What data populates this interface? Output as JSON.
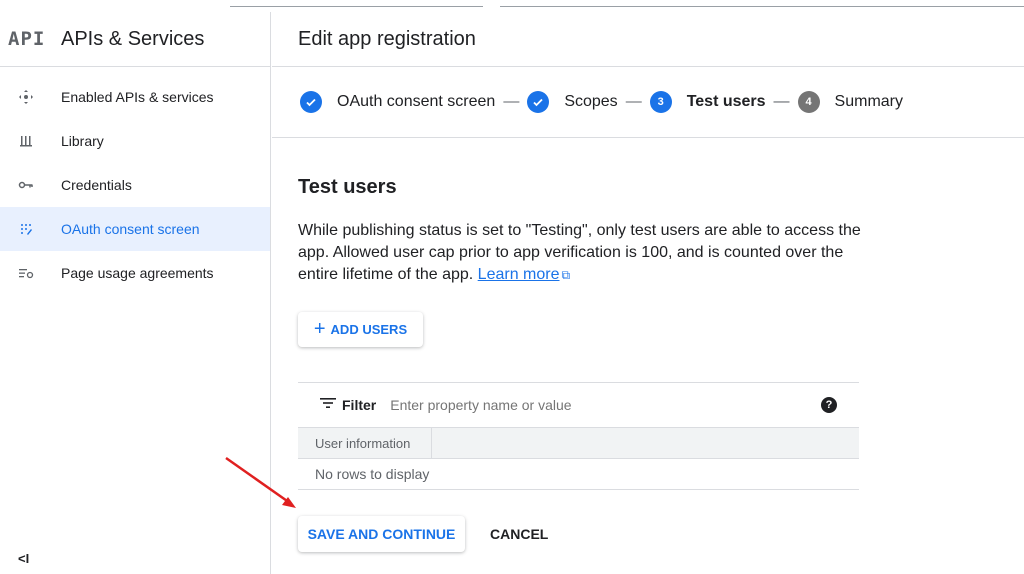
{
  "sidebar": {
    "logo": "API",
    "title": "APIs & Services",
    "items": [
      {
        "label": "Enabled APIs & services",
        "icon": "api-nodes-icon"
      },
      {
        "label": "Library",
        "icon": "library-icon"
      },
      {
        "label": "Credentials",
        "icon": "key-icon"
      },
      {
        "label": "OAuth consent screen",
        "icon": "oauth-grid-icon",
        "active": true
      },
      {
        "label": "Page usage agreements",
        "icon": "settings-list-icon"
      }
    ],
    "collapse_label": "<I"
  },
  "main": {
    "header_title": "Edit app registration",
    "steps": [
      {
        "label": "OAuth consent screen",
        "state": "done"
      },
      {
        "label": "Scopes",
        "state": "done"
      },
      {
        "label": "Test users",
        "number": "3",
        "state": "current"
      },
      {
        "label": "Summary",
        "number": "4",
        "state": "todo"
      }
    ],
    "section_title": "Test users",
    "description": "While publishing status is set to \"Testing\", only test users are able to access the app. Allowed user cap prior to app verification is 100, and is counted over the entire lifetime of the app.",
    "learn_more": "Learn more",
    "add_users_label": "ADD USERS",
    "filter": {
      "label": "Filter",
      "placeholder": "Enter property name or value"
    },
    "table": {
      "columns": [
        "User information"
      ],
      "empty_text": "No rows to display"
    },
    "save_label": "SAVE AND CONTINUE",
    "cancel_label": "CANCEL"
  },
  "colors": {
    "accent": "#1a73e8",
    "active_bg": "#e8f0fe",
    "annotation_arrow": "#e02020"
  }
}
